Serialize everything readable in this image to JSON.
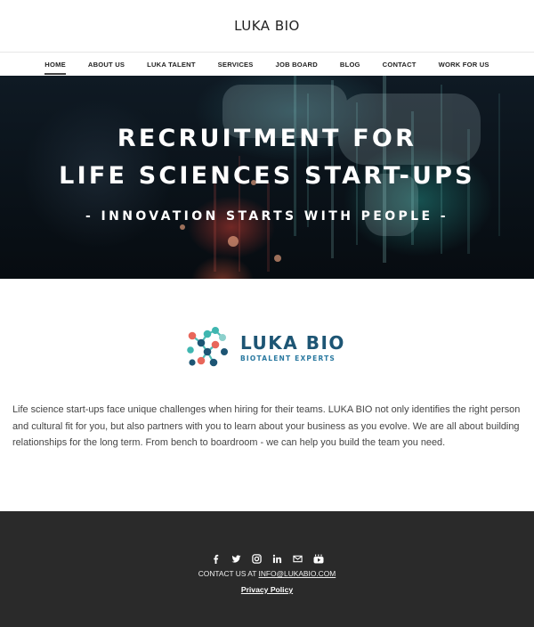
{
  "header": {
    "site_title": "LUKA BIO"
  },
  "nav": {
    "items": [
      {
        "label": "HOME"
      },
      {
        "label": "ABOUT US"
      },
      {
        "label": "LUKA TALENT"
      },
      {
        "label": "SERVICES"
      },
      {
        "label": "JOB BOARD"
      },
      {
        "label": "BLOG"
      },
      {
        "label": "CONTACT"
      },
      {
        "label": "WORK FOR US"
      }
    ],
    "active": "HOME"
  },
  "hero": {
    "line1": "RECRUITMENT FOR",
    "line2": "LIFE SCIENCES START-UPS",
    "subtitle": "- INNOVATION STARTS WITH PEOPLE -"
  },
  "logo": {
    "name": "LUKA BIO",
    "tagline": "BIOTALENT EXPERTS"
  },
  "main": {
    "paragraph": "Life science start-ups face unique challenges when hiring for their teams. LUKA BIO not only identifies the right person and cultural fit for you, but also partners with you to learn about your business as you evolve. We are all about building relationships for the long term. From bench to boardroom - we can help you build the team you need."
  },
  "footer": {
    "social": [
      "facebook-icon",
      "twitter-icon",
      "instagram-icon",
      "linkedin-icon",
      "email-icon",
      "youtube-icon"
    ],
    "contact_prefix": "CONTACT US AT",
    "contact_email": "INFO@LUKABIO.COM",
    "privacy": "Privacy Policy"
  },
  "colors": {
    "brand_dark": "#1d5574",
    "brand_teal": "#3fb6b0",
    "brand_coral": "#e8665a",
    "footer_bg": "#2a2a2a"
  }
}
